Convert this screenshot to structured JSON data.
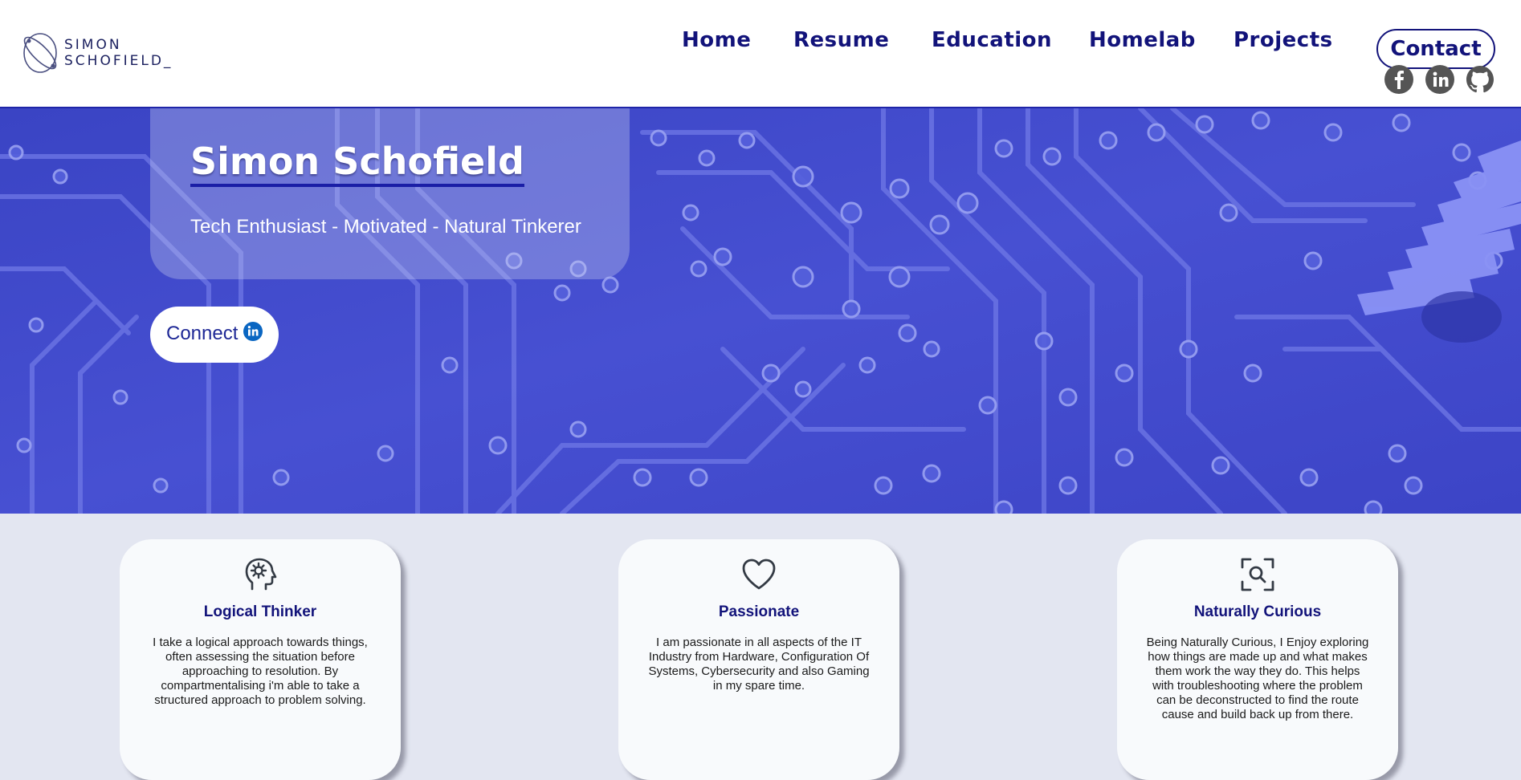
{
  "logo": {
    "line1": "Simon",
    "line2": "Schofield_"
  },
  "nav": {
    "items": [
      {
        "label": "Home"
      },
      {
        "label": "Resume"
      },
      {
        "label": "Education"
      },
      {
        "label": "Homelab"
      },
      {
        "label": "Projects"
      }
    ],
    "contact_label": "Contact"
  },
  "social": {
    "icons": [
      "facebook-icon",
      "linkedin-icon",
      "github-icon"
    ],
    "color": "#555555"
  },
  "hero": {
    "name": "Simon Schofield",
    "tagline": "Tech Enthusiast - Motivated - Natural Tinkerer",
    "connect_label": "Connect",
    "connect_icon": "linkedin-icon"
  },
  "cards": [
    {
      "icon": "head-gear-icon",
      "title": "Logical Thinker",
      "text": "I take a logical approach towards things, often assessing the situation before approaching to resolution. By compartmentalising i'm able to take a structured approach to problem solving."
    },
    {
      "icon": "heart-icon",
      "title": "Passionate",
      "text": "I am passionate in all aspects of the IT Industry from Hardware, Configuration Of Systems, Cybersecurity and also Gaming in my spare time."
    },
    {
      "icon": "search-scan-icon",
      "title": "Naturally Curious",
      "text": "Being Naturally Curious, I Enjoy exploring how things are made up and what makes them work the way they do. This helps with troubleshooting where the problem can be deconstructed to find the route cause and build back up from there."
    }
  ],
  "colors": {
    "brand_navy": "#12137a",
    "hero_blue": "#4048cc",
    "page_bg": "#e3e6f1",
    "linkedin": "#0a66c2"
  }
}
